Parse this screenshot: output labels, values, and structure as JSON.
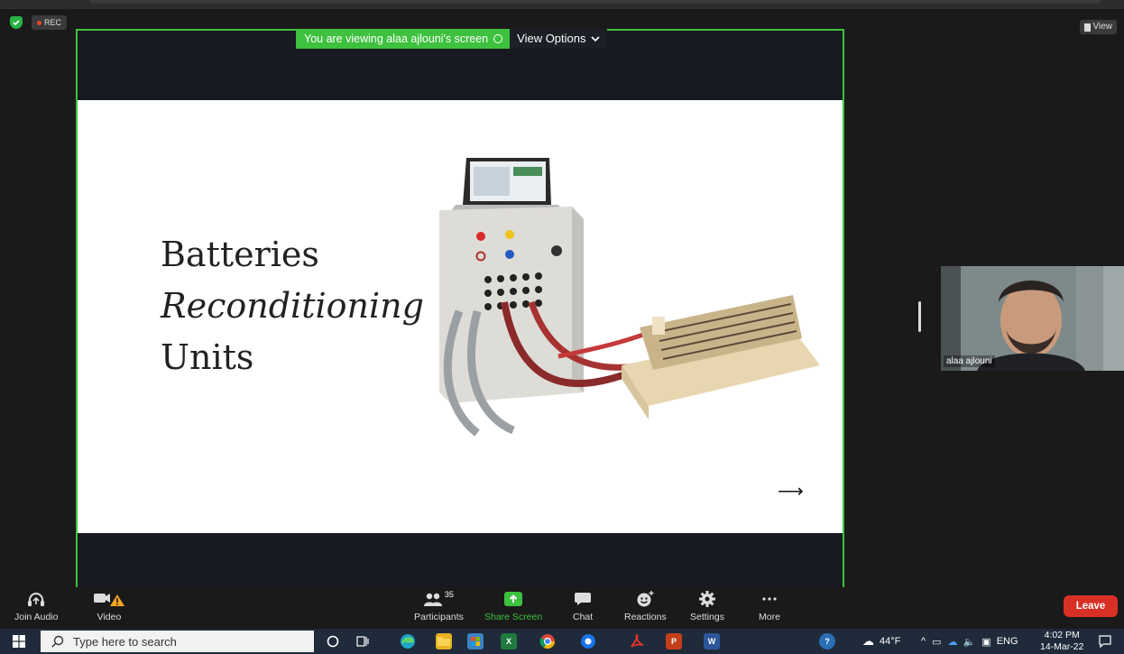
{
  "meeting": {
    "rec_label": "REC",
    "view_label": "View",
    "share_banner": "You are viewing alaa ajlouni's screen",
    "view_options": "View Options"
  },
  "slide": {
    "line1": "Batteries",
    "line2": "Reconditioning",
    "line3": "Units",
    "arrow": "⟶"
  },
  "speaker": {
    "name": "alaa ajlouni"
  },
  "controls": {
    "join_audio": "Join Audio",
    "video": "Video",
    "participants": "Participants",
    "participants_count": "35",
    "share_screen": "Share Screen",
    "chat": "Chat",
    "reactions": "Reactions",
    "settings": "Settings",
    "more": "More",
    "leave": "Leave"
  },
  "taskbar": {
    "search_placeholder": "Type here to search",
    "weather": "44°F",
    "language": "ENG",
    "time": "4:02 PM",
    "date": "14-Mar-22"
  },
  "colors": {
    "accent_green": "#3ec13e",
    "leave_red": "#d93025"
  }
}
